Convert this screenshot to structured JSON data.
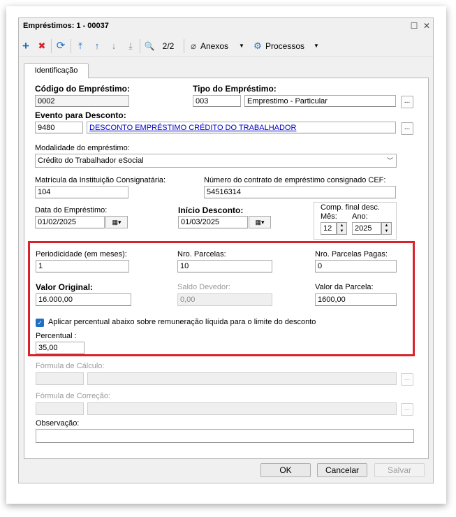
{
  "window": {
    "title": "Empréstimos: 1 - 00037",
    "maximize_glyph": "☐",
    "close_glyph": "✕"
  },
  "toolbar": {
    "add_glyph": "+",
    "delete_glyph": "✖",
    "refresh_glyph": "⟳",
    "first_glyph": "⤒",
    "prev_glyph": "↑",
    "next_glyph": "↓",
    "last_glyph": "⤓",
    "search_glyph": "🔍",
    "record_counter": "2/2",
    "attachments_label": "Anexos",
    "processes_label": "Processos",
    "dropdown_glyph": "▼",
    "colors": {
      "add": "#1f6fc4",
      "delete": "#d9222a",
      "nav": "#1f6fc4"
    }
  },
  "tabs": [
    {
      "label": "Identificação"
    }
  ],
  "form": {
    "codigo": {
      "label": "Código do Empréstimo:",
      "value": "0002"
    },
    "tipo": {
      "label": "Tipo do Empréstimo:",
      "code": "003",
      "description": "Emprestimo - Particular"
    },
    "evento": {
      "label": "Evento para Desconto:",
      "code": "9480",
      "description": "DESCONTO EMPRÉSTIMO CRÉDITO DO TRABALHADOR"
    },
    "modalidade": {
      "label": "Modalidade do empréstimo:",
      "value": "Crédito do Trabalhador eSocial"
    },
    "matricula": {
      "label": "Matrícula da Instituição Consignatária:",
      "value": "104"
    },
    "contrato": {
      "label": "Número do contrato de empréstimo consignado CEF:",
      "value": "54516314"
    },
    "data_emprestimo": {
      "label": "Data do Empréstimo:",
      "value": "01/02/2025"
    },
    "inicio_desconto": {
      "label": "Início Desconto:",
      "value": "01/03/2025"
    },
    "comp_final": {
      "label": "Comp. final desc.",
      "mes_label": "Mês:",
      "mes": "12",
      "ano_label": "Ano:",
      "ano": "2025"
    },
    "periodicidade": {
      "label": "Periodicidade (em meses):",
      "value": "1"
    },
    "parcelas": {
      "label": "Nro. Parcelas:",
      "value": "10"
    },
    "parcelas_pagas": {
      "label": "Nro. Parcelas Pagas:",
      "value": "0"
    },
    "valor_original": {
      "label": "Valor Original:",
      "value": "16.000,00"
    },
    "saldo_devedor": {
      "label": "Saldo Devedor:",
      "value": "0,00"
    },
    "valor_parcela": {
      "label": "Valor da Parcela:",
      "value": "1600,00"
    },
    "aplicar_percentual": {
      "label": "Aplicar percentual abaixo sobre remuneração líquida para o limite do desconto",
      "checked": true
    },
    "percentual": {
      "label": "Percentual :",
      "value": "35,00"
    },
    "formula_calculo": {
      "label": "Fórmula de Cálculo:"
    },
    "formula_correcao": {
      "label": "Fórmula de Correção:"
    },
    "observacao": {
      "label": "Observação:",
      "value": ""
    },
    "ellipsis": "..."
  },
  "footer": {
    "ok": "OK",
    "cancel": "Cancelar",
    "save": "Salvar"
  },
  "highlight_color": "#d9222a"
}
